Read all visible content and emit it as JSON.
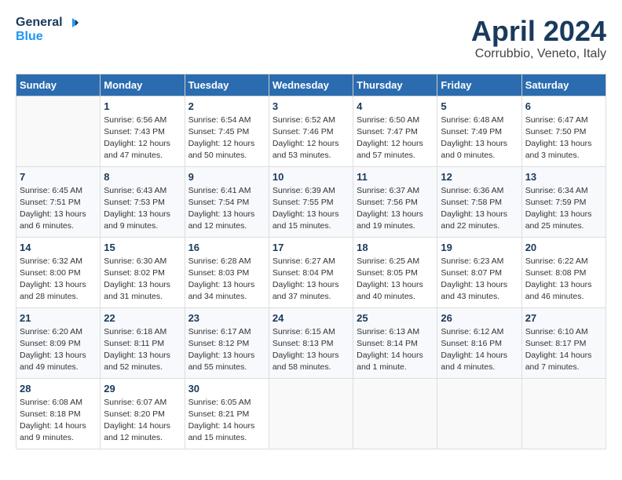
{
  "header": {
    "logo_line1": "General",
    "logo_line2": "Blue",
    "month": "April 2024",
    "location": "Corrubbio, Veneto, Italy"
  },
  "columns": [
    "Sunday",
    "Monday",
    "Tuesday",
    "Wednesday",
    "Thursday",
    "Friday",
    "Saturday"
  ],
  "weeks": [
    [
      {
        "day": "",
        "info": ""
      },
      {
        "day": "1",
        "info": "Sunrise: 6:56 AM\nSunset: 7:43 PM\nDaylight: 12 hours\nand 47 minutes."
      },
      {
        "day": "2",
        "info": "Sunrise: 6:54 AM\nSunset: 7:45 PM\nDaylight: 12 hours\nand 50 minutes."
      },
      {
        "day": "3",
        "info": "Sunrise: 6:52 AM\nSunset: 7:46 PM\nDaylight: 12 hours\nand 53 minutes."
      },
      {
        "day": "4",
        "info": "Sunrise: 6:50 AM\nSunset: 7:47 PM\nDaylight: 12 hours\nand 57 minutes."
      },
      {
        "day": "5",
        "info": "Sunrise: 6:48 AM\nSunset: 7:49 PM\nDaylight: 13 hours\nand 0 minutes."
      },
      {
        "day": "6",
        "info": "Sunrise: 6:47 AM\nSunset: 7:50 PM\nDaylight: 13 hours\nand 3 minutes."
      }
    ],
    [
      {
        "day": "7",
        "info": "Sunrise: 6:45 AM\nSunset: 7:51 PM\nDaylight: 13 hours\nand 6 minutes."
      },
      {
        "day": "8",
        "info": "Sunrise: 6:43 AM\nSunset: 7:53 PM\nDaylight: 13 hours\nand 9 minutes."
      },
      {
        "day": "9",
        "info": "Sunrise: 6:41 AM\nSunset: 7:54 PM\nDaylight: 13 hours\nand 12 minutes."
      },
      {
        "day": "10",
        "info": "Sunrise: 6:39 AM\nSunset: 7:55 PM\nDaylight: 13 hours\nand 15 minutes."
      },
      {
        "day": "11",
        "info": "Sunrise: 6:37 AM\nSunset: 7:56 PM\nDaylight: 13 hours\nand 19 minutes."
      },
      {
        "day": "12",
        "info": "Sunrise: 6:36 AM\nSunset: 7:58 PM\nDaylight: 13 hours\nand 22 minutes."
      },
      {
        "day": "13",
        "info": "Sunrise: 6:34 AM\nSunset: 7:59 PM\nDaylight: 13 hours\nand 25 minutes."
      }
    ],
    [
      {
        "day": "14",
        "info": "Sunrise: 6:32 AM\nSunset: 8:00 PM\nDaylight: 13 hours\nand 28 minutes."
      },
      {
        "day": "15",
        "info": "Sunrise: 6:30 AM\nSunset: 8:02 PM\nDaylight: 13 hours\nand 31 minutes."
      },
      {
        "day": "16",
        "info": "Sunrise: 6:28 AM\nSunset: 8:03 PM\nDaylight: 13 hours\nand 34 minutes."
      },
      {
        "day": "17",
        "info": "Sunrise: 6:27 AM\nSunset: 8:04 PM\nDaylight: 13 hours\nand 37 minutes."
      },
      {
        "day": "18",
        "info": "Sunrise: 6:25 AM\nSunset: 8:05 PM\nDaylight: 13 hours\nand 40 minutes."
      },
      {
        "day": "19",
        "info": "Sunrise: 6:23 AM\nSunset: 8:07 PM\nDaylight: 13 hours\nand 43 minutes."
      },
      {
        "day": "20",
        "info": "Sunrise: 6:22 AM\nSunset: 8:08 PM\nDaylight: 13 hours\nand 46 minutes."
      }
    ],
    [
      {
        "day": "21",
        "info": "Sunrise: 6:20 AM\nSunset: 8:09 PM\nDaylight: 13 hours\nand 49 minutes."
      },
      {
        "day": "22",
        "info": "Sunrise: 6:18 AM\nSunset: 8:11 PM\nDaylight: 13 hours\nand 52 minutes."
      },
      {
        "day": "23",
        "info": "Sunrise: 6:17 AM\nSunset: 8:12 PM\nDaylight: 13 hours\nand 55 minutes."
      },
      {
        "day": "24",
        "info": "Sunrise: 6:15 AM\nSunset: 8:13 PM\nDaylight: 13 hours\nand 58 minutes."
      },
      {
        "day": "25",
        "info": "Sunrise: 6:13 AM\nSunset: 8:14 PM\nDaylight: 14 hours\nand 1 minute."
      },
      {
        "day": "26",
        "info": "Sunrise: 6:12 AM\nSunset: 8:16 PM\nDaylight: 14 hours\nand 4 minutes."
      },
      {
        "day": "27",
        "info": "Sunrise: 6:10 AM\nSunset: 8:17 PM\nDaylight: 14 hours\nand 7 minutes."
      }
    ],
    [
      {
        "day": "28",
        "info": "Sunrise: 6:08 AM\nSunset: 8:18 PM\nDaylight: 14 hours\nand 9 minutes."
      },
      {
        "day": "29",
        "info": "Sunrise: 6:07 AM\nSunset: 8:20 PM\nDaylight: 14 hours\nand 12 minutes."
      },
      {
        "day": "30",
        "info": "Sunrise: 6:05 AM\nSunset: 8:21 PM\nDaylight: 14 hours\nand 15 minutes."
      },
      {
        "day": "",
        "info": ""
      },
      {
        "day": "",
        "info": ""
      },
      {
        "day": "",
        "info": ""
      },
      {
        "day": "",
        "info": ""
      }
    ]
  ]
}
